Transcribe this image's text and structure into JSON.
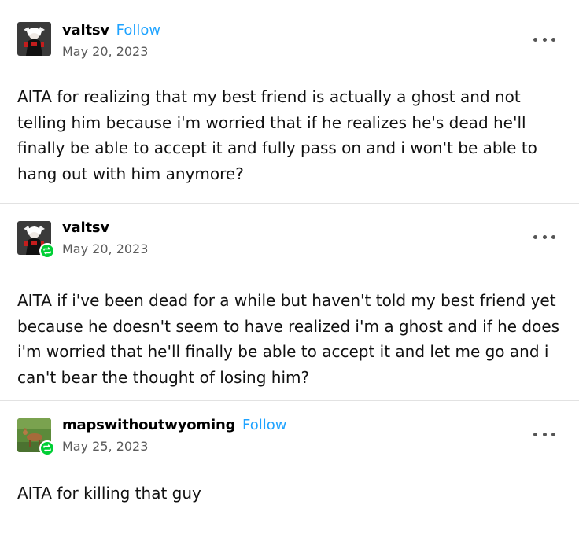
{
  "posts": [
    {
      "username": "valtsv",
      "follow_label": "Follow",
      "date": "May 20, 2023",
      "avatar": "valtsv-avatar",
      "reblogged": false,
      "text": "AITA for realizing that my best friend is actually a ghost and not telling him because i'm worried that if he realizes he's dead he'll finally be able to accept it and fully pass on and i won't be able to hang out with him anymore?"
    },
    {
      "username": "valtsv",
      "date": "May 20, 2023",
      "avatar": "valtsv-avatar",
      "reblogged": true,
      "text": "AITA if i've been dead for a while but haven't told my best friend yet because he doesn't seem to have realized i'm a ghost and if he does i'm worried that he'll finally be able to accept it and let me go and i can't bear the thought of losing him?"
    },
    {
      "username": "mapswithoutwyoming",
      "follow_label": "Follow",
      "date": "May 25, 2023",
      "avatar": "deer-avatar",
      "reblogged": true,
      "text": "AITA for killing that guy"
    }
  ],
  "colors": {
    "follow": "#1fa3ff",
    "reblog_badge": "#00cf35",
    "date": "#5b5b5b",
    "divider": "#e2e2e2"
  },
  "icons": {
    "more": "more-options-icon",
    "reblog": "reblog-icon"
  }
}
